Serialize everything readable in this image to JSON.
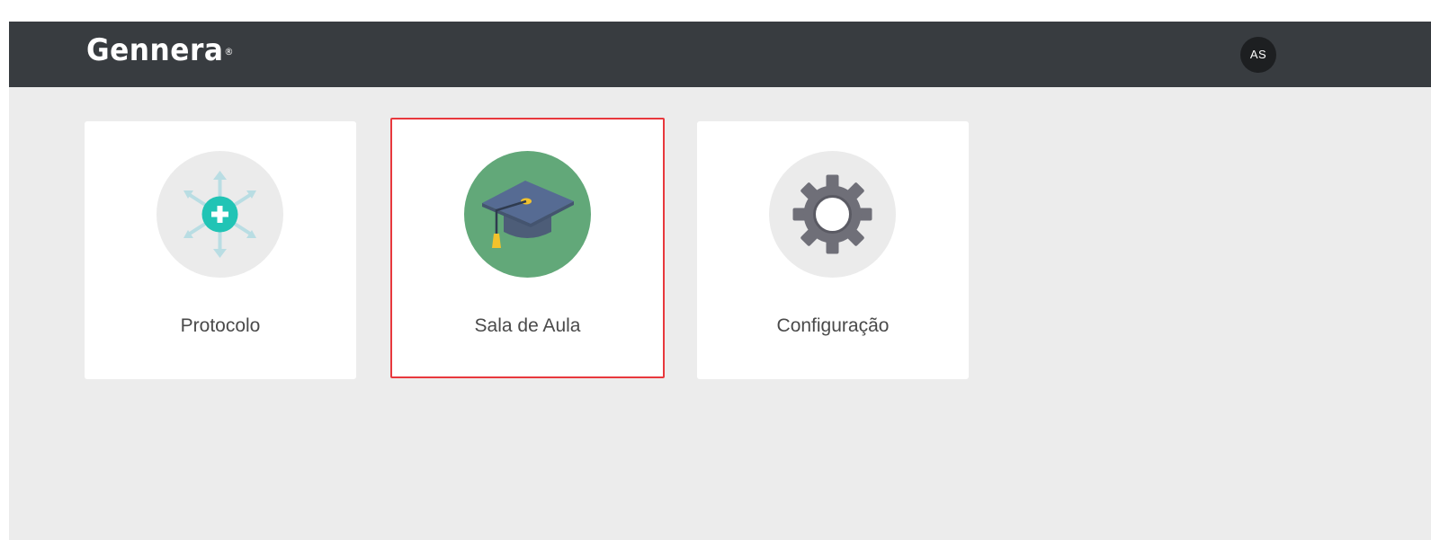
{
  "header": {
    "logo_text": "Gennera",
    "logo_mark": "®",
    "user_initials": "AS"
  },
  "modules": [
    {
      "label": "Protocolo",
      "icon": "protocol-icon",
      "circle_color": "#ebebeb",
      "selected": false
    },
    {
      "label": "Sala de Aula",
      "icon": "graduation-cap-icon",
      "circle_color": "#62a879",
      "selected": true
    },
    {
      "label": "Configuração",
      "icon": "gear-icon",
      "circle_color": "#ebebeb",
      "selected": false
    }
  ],
  "colors": {
    "topbar": "#383c40",
    "background": "#ececec",
    "selection_border": "#e8383d",
    "protocol_accent": "#21c4b5"
  }
}
